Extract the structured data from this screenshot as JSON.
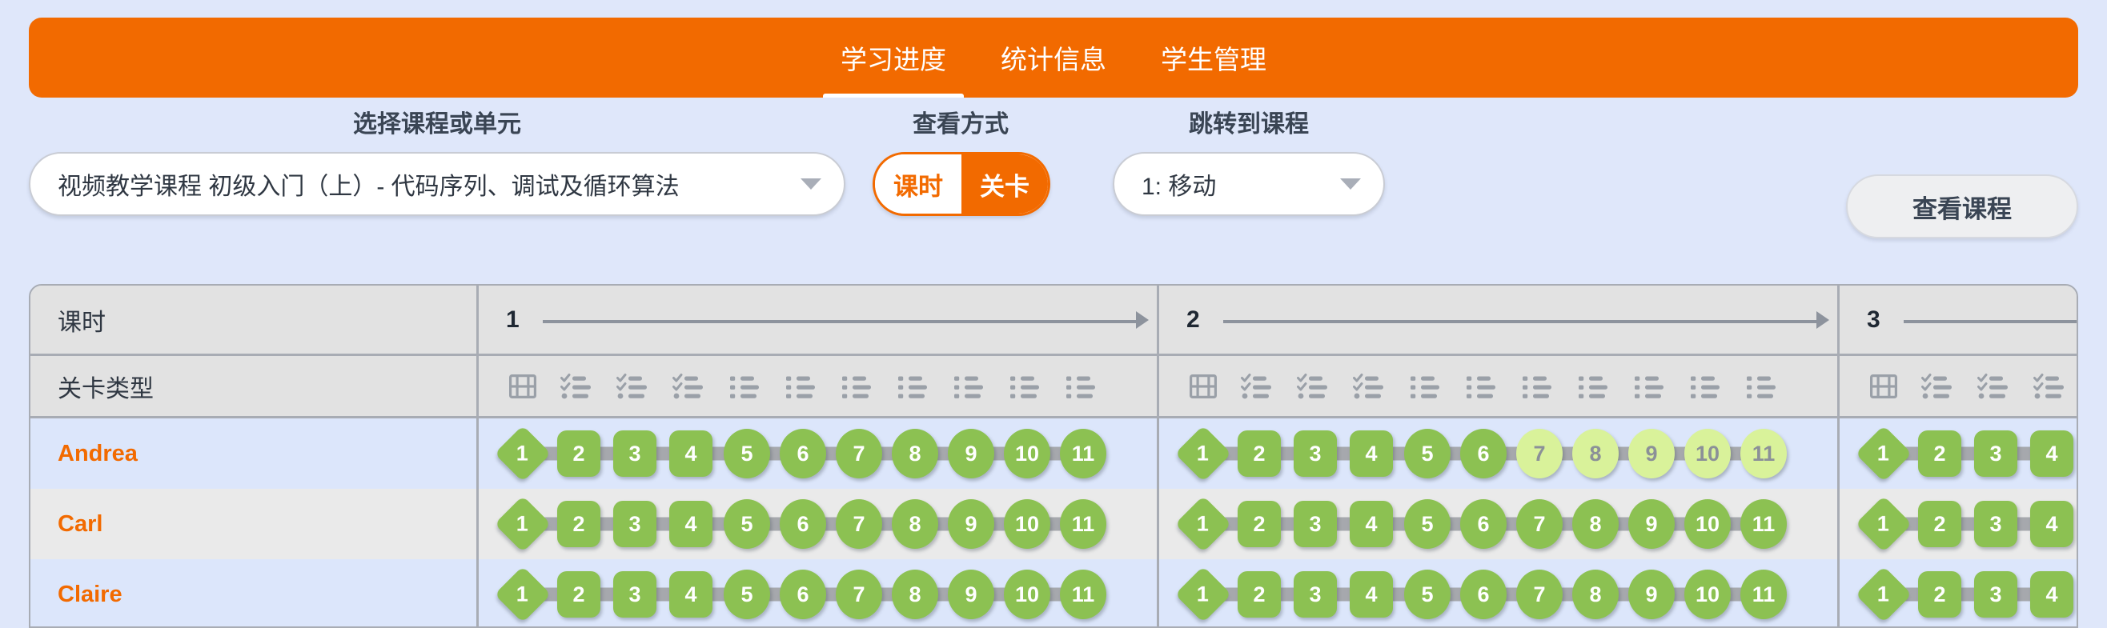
{
  "nav": {
    "tabs": [
      {
        "label": "学习进度",
        "active": true
      },
      {
        "label": "统计信息",
        "active": false
      },
      {
        "label": "学生管理",
        "active": false
      }
    ],
    "accent_color": "#f26a00"
  },
  "filters": {
    "course": {
      "label": "选择课程或单元",
      "value": "视频教学课程 初级入门（上）- 代码序列、调试及循环算法",
      "caret_icon": "chevron-down-icon"
    },
    "view_mode": {
      "label": "查看方式",
      "options": [
        {
          "label": "课时",
          "selected": false
        },
        {
          "label": "关卡",
          "selected": true
        }
      ]
    },
    "jump_to_lesson": {
      "label": "跳转到课程",
      "value": "1: 移动",
      "caret_icon": "chevron-down-icon"
    },
    "view_course_button": "查看课程"
  },
  "table": {
    "row_headers": {
      "lessons": "课时",
      "level_types": "关卡类型"
    },
    "lessons": [
      {
        "number": "1",
        "arrow": true,
        "truncated": false,
        "level_types": [
          "video-icon",
          "checklist-icon",
          "checklist-icon",
          "checklist-icon",
          "bullet-list-icon",
          "bullet-list-icon",
          "bullet-list-icon",
          "bullet-list-icon",
          "bullet-list-icon",
          "bullet-list-icon",
          "bullet-list-icon"
        ]
      },
      {
        "number": "2",
        "arrow": true,
        "truncated": false,
        "level_types": [
          "video-icon",
          "checklist-icon",
          "checklist-icon",
          "checklist-icon",
          "bullet-list-icon",
          "bullet-list-icon",
          "bullet-list-icon",
          "bullet-list-icon",
          "bullet-list-icon",
          "bullet-list-icon",
          "bullet-list-icon"
        ]
      },
      {
        "number": "3",
        "arrow": false,
        "truncated": true,
        "level_types": [
          "video-icon",
          "checklist-icon",
          "checklist-icon",
          "checklist-icon"
        ]
      }
    ],
    "students": [
      {
        "name": "Andrea",
        "lessons": [
          {
            "badges": [
              {
                "label": "1",
                "type": "video",
                "complete": true
              },
              {
                "label": "2",
                "type": "check",
                "complete": true
              },
              {
                "label": "3",
                "type": "check",
                "complete": true
              },
              {
                "label": "4",
                "type": "check",
                "complete": true
              },
              {
                "label": "5",
                "type": "list",
                "complete": true
              },
              {
                "label": "6",
                "type": "list",
                "complete": true
              },
              {
                "label": "7",
                "type": "list",
                "complete": true
              },
              {
                "label": "8",
                "type": "list",
                "complete": true
              },
              {
                "label": "9",
                "type": "list",
                "complete": true
              },
              {
                "label": "10",
                "type": "list",
                "complete": true
              },
              {
                "label": "11",
                "type": "list",
                "complete": true
              }
            ]
          },
          {
            "badges": [
              {
                "label": "1",
                "type": "video",
                "complete": true
              },
              {
                "label": "2",
                "type": "check",
                "complete": true
              },
              {
                "label": "3",
                "type": "check",
                "complete": true
              },
              {
                "label": "4",
                "type": "check",
                "complete": true
              },
              {
                "label": "5",
                "type": "list",
                "complete": true
              },
              {
                "label": "6",
                "type": "list",
                "complete": true
              },
              {
                "label": "7",
                "type": "list",
                "complete": false
              },
              {
                "label": "8",
                "type": "list",
                "complete": false
              },
              {
                "label": "9",
                "type": "list",
                "complete": false
              },
              {
                "label": "10",
                "type": "list",
                "complete": false
              },
              {
                "label": "11",
                "type": "list",
                "complete": false
              }
            ]
          },
          {
            "badges": [
              {
                "label": "1",
                "type": "video",
                "complete": true
              },
              {
                "label": "2",
                "type": "check",
                "complete": true
              },
              {
                "label": "3",
                "type": "check",
                "complete": true
              },
              {
                "label": "4",
                "type": "check",
                "complete": true
              }
            ]
          }
        ]
      },
      {
        "name": "Carl",
        "lessons": [
          {
            "badges": [
              {
                "label": "1",
                "type": "video",
                "complete": true
              },
              {
                "label": "2",
                "type": "check",
                "complete": true
              },
              {
                "label": "3",
                "type": "check",
                "complete": true
              },
              {
                "label": "4",
                "type": "check",
                "complete": true
              },
              {
                "label": "5",
                "type": "list",
                "complete": true
              },
              {
                "label": "6",
                "type": "list",
                "complete": true
              },
              {
                "label": "7",
                "type": "list",
                "complete": true
              },
              {
                "label": "8",
                "type": "list",
                "complete": true
              },
              {
                "label": "9",
                "type": "list",
                "complete": true
              },
              {
                "label": "10",
                "type": "list",
                "complete": true
              },
              {
                "label": "11",
                "type": "list",
                "complete": true
              }
            ]
          },
          {
            "badges": [
              {
                "label": "1",
                "type": "video",
                "complete": true
              },
              {
                "label": "2",
                "type": "check",
                "complete": true
              },
              {
                "label": "3",
                "type": "check",
                "complete": true
              },
              {
                "label": "4",
                "type": "check",
                "complete": true
              },
              {
                "label": "5",
                "type": "list",
                "complete": true
              },
              {
                "label": "6",
                "type": "list",
                "complete": true
              },
              {
                "label": "7",
                "type": "list",
                "complete": true
              },
              {
                "label": "8",
                "type": "list",
                "complete": true
              },
              {
                "label": "9",
                "type": "list",
                "complete": true
              },
              {
                "label": "10",
                "type": "list",
                "complete": true
              },
              {
                "label": "11",
                "type": "list",
                "complete": true
              }
            ]
          },
          {
            "badges": [
              {
                "label": "1",
                "type": "video",
                "complete": true
              },
              {
                "label": "2",
                "type": "check",
                "complete": true
              },
              {
                "label": "3",
                "type": "check",
                "complete": true
              },
              {
                "label": "4",
                "type": "check",
                "complete": true
              }
            ]
          }
        ]
      },
      {
        "name": "Claire",
        "lessons": [
          {
            "badges": [
              {
                "label": "1",
                "type": "video",
                "complete": true
              },
              {
                "label": "2",
                "type": "check",
                "complete": true
              },
              {
                "label": "3",
                "type": "check",
                "complete": true
              },
              {
                "label": "4",
                "type": "check",
                "complete": true
              },
              {
                "label": "5",
                "type": "list",
                "complete": true
              },
              {
                "label": "6",
                "type": "list",
                "complete": true
              },
              {
                "label": "7",
                "type": "list",
                "complete": true
              },
              {
                "label": "8",
                "type": "list",
                "complete": true
              },
              {
                "label": "9",
                "type": "list",
                "complete": true
              },
              {
                "label": "10",
                "type": "list",
                "complete": true
              },
              {
                "label": "11",
                "type": "list",
                "complete": true
              }
            ]
          },
          {
            "badges": [
              {
                "label": "1",
                "type": "video",
                "complete": true
              },
              {
                "label": "2",
                "type": "check",
                "complete": true
              },
              {
                "label": "3",
                "type": "check",
                "complete": true
              },
              {
                "label": "4",
                "type": "check",
                "complete": true
              },
              {
                "label": "5",
                "type": "list",
                "complete": true
              },
              {
                "label": "6",
                "type": "list",
                "complete": true
              },
              {
                "label": "7",
                "type": "list",
                "complete": true
              },
              {
                "label": "8",
                "type": "list",
                "complete": true
              },
              {
                "label": "9",
                "type": "list",
                "complete": true
              },
              {
                "label": "10",
                "type": "list",
                "complete": true
              },
              {
                "label": "11",
                "type": "list",
                "complete": true
              }
            ]
          },
          {
            "badges": [
              {
                "label": "1",
                "type": "video",
                "complete": true
              },
              {
                "label": "2",
                "type": "check",
                "complete": true
              },
              {
                "label": "3",
                "type": "check",
                "complete": true
              },
              {
                "label": "4",
                "type": "check",
                "complete": true
              }
            ]
          }
        ]
      }
    ]
  },
  "colors": {
    "accent": "#f26a00",
    "page_bg": "#dfe7fa",
    "badge_complete": "#8cc152",
    "badge_incomplete": "#d9f29a",
    "row_odd": "#dce6fb",
    "row_even": "#eaeaea"
  }
}
